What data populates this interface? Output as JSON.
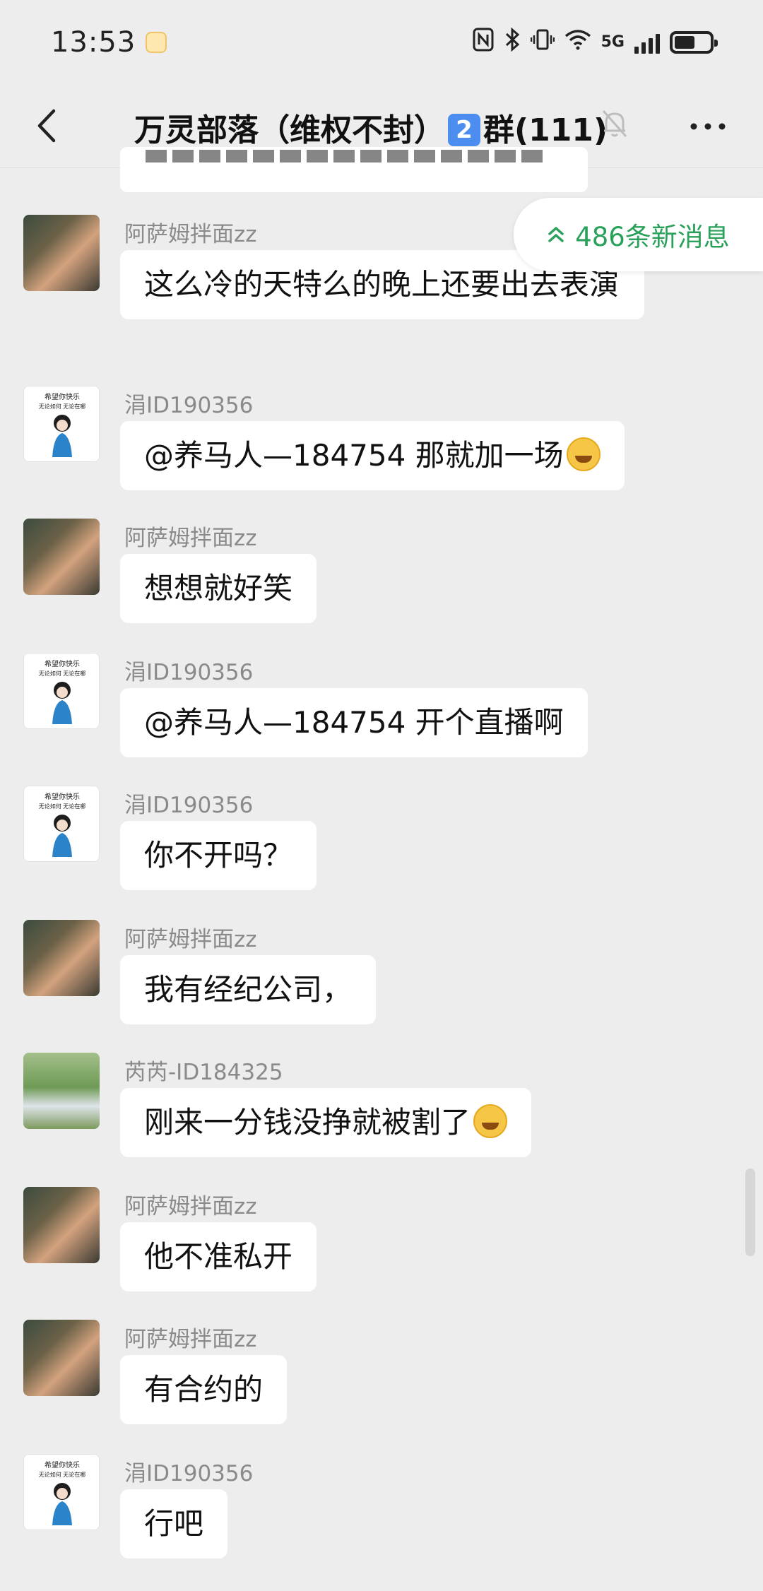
{
  "status_bar": {
    "time": "13:53",
    "network": "5G",
    "battery_level": 0.58
  },
  "header": {
    "title_prefix": "万灵部落（维权不封）",
    "title_badge": "2",
    "title_suffix": "群(111)",
    "back_icon": "chevron-left-icon",
    "mute_icon": "bell-off-icon",
    "more_icon": "more-icon"
  },
  "new_messages": {
    "label": "486条新消息",
    "icon": "double-chevron-up-icon",
    "color": "#2aa15a"
  },
  "messages": [
    {
      "sender": "阿萨姆拌面zz",
      "text": "这么冷的天特么的晚上还要出去表演"
    },
    {
      "sender": "涓ID190356",
      "text": "@养马人—184754  那就加一场"
    },
    {
      "sender": "阿萨姆拌面zz",
      "text": "想想就好笑"
    },
    {
      "sender": "涓ID190356",
      "text": "@养马人—184754  开个直播啊"
    },
    {
      "sender": "涓ID190356",
      "text": "你不开吗？"
    },
    {
      "sender": "阿萨姆拌面zz",
      "text": "我有经纪公司，"
    },
    {
      "sender": "芮芮-ID184325",
      "text": "刚来一分钱没挣就被割了"
    },
    {
      "sender": "阿萨姆拌面zz",
      "text": "他不准私开"
    },
    {
      "sender": "阿萨姆拌面zz",
      "text": "有合约的"
    },
    {
      "sender": "涓ID190356",
      "text": "行吧"
    }
  ],
  "avatar_girl_caption": [
    "希望你快乐",
    "无论如何 无论在哪"
  ]
}
